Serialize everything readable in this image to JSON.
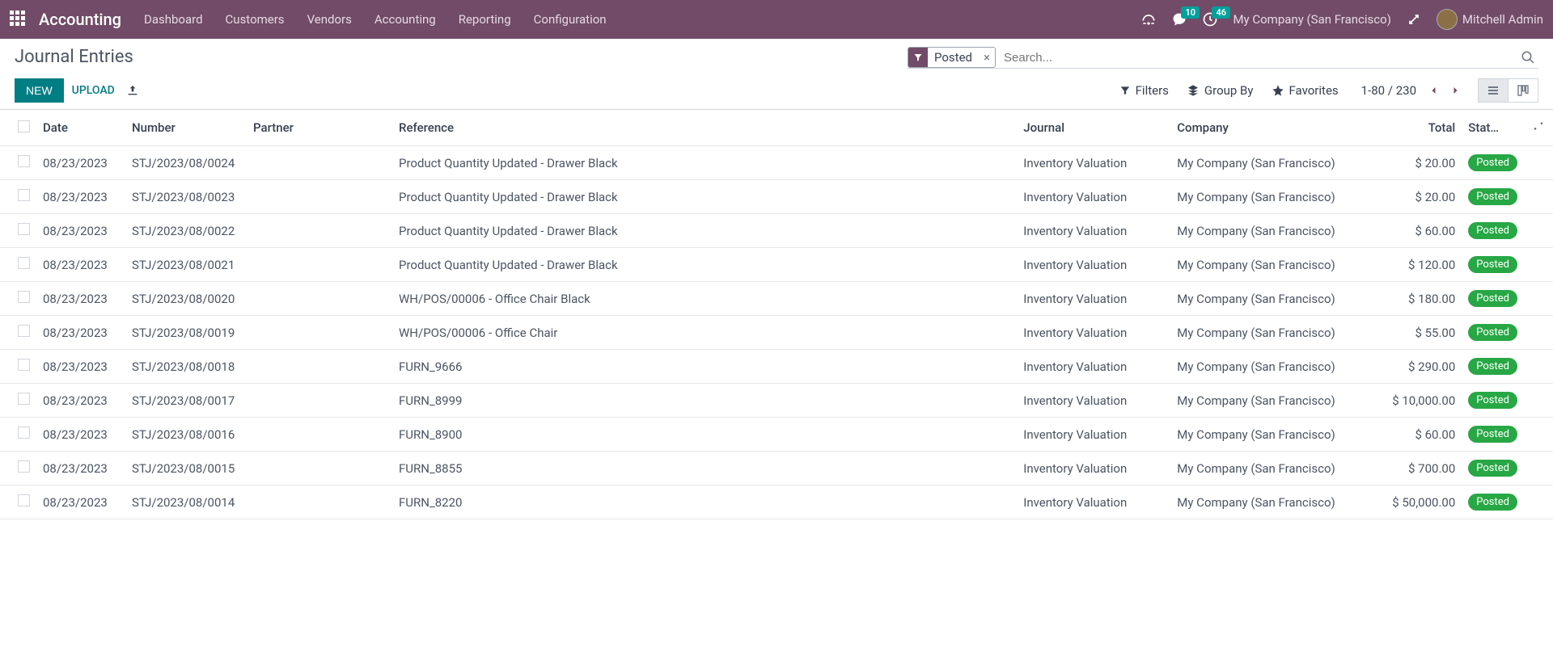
{
  "topbar": {
    "app_title": "Accounting",
    "menu": [
      "Dashboard",
      "Customers",
      "Vendors",
      "Accounting",
      "Reporting",
      "Configuration"
    ],
    "messages_badge": "10",
    "activities_badge": "46",
    "company": "My Company (San Francisco)",
    "user": "Mitchell Admin"
  },
  "control": {
    "breadcrumb": "Journal Entries",
    "new_btn": "NEW",
    "upload_btn": "UPLOAD",
    "filter_facet": "Posted",
    "search_placeholder": "Search...",
    "filters": "Filters",
    "groupby": "Group By",
    "favorites": "Favorites",
    "pager": "1-80 / 230"
  },
  "table": {
    "headers": {
      "date": "Date",
      "number": "Number",
      "partner": "Partner",
      "reference": "Reference",
      "journal": "Journal",
      "company": "Company",
      "total": "Total",
      "status": "Stat…"
    },
    "rows": [
      {
        "date": "08/23/2023",
        "number": "STJ/2023/08/0024",
        "partner": "",
        "reference": "Product Quantity Updated - Drawer Black",
        "journal": "Inventory Valuation",
        "company": "My Company (San Francisco)",
        "total": "$ 20.00",
        "status": "Posted"
      },
      {
        "date": "08/23/2023",
        "number": "STJ/2023/08/0023",
        "partner": "",
        "reference": "Product Quantity Updated - Drawer Black",
        "journal": "Inventory Valuation",
        "company": "My Company (San Francisco)",
        "total": "$ 20.00",
        "status": "Posted"
      },
      {
        "date": "08/23/2023",
        "number": "STJ/2023/08/0022",
        "partner": "",
        "reference": "Product Quantity Updated - Drawer Black",
        "journal": "Inventory Valuation",
        "company": "My Company (San Francisco)",
        "total": "$ 60.00",
        "status": "Posted"
      },
      {
        "date": "08/23/2023",
        "number": "STJ/2023/08/0021",
        "partner": "",
        "reference": "Product Quantity Updated - Drawer Black",
        "journal": "Inventory Valuation",
        "company": "My Company (San Francisco)",
        "total": "$ 120.00",
        "status": "Posted"
      },
      {
        "date": "08/23/2023",
        "number": "STJ/2023/08/0020",
        "partner": "",
        "reference": "WH/POS/00006 - Office Chair Black",
        "journal": "Inventory Valuation",
        "company": "My Company (San Francisco)",
        "total": "$ 180.00",
        "status": "Posted"
      },
      {
        "date": "08/23/2023",
        "number": "STJ/2023/08/0019",
        "partner": "",
        "reference": "WH/POS/00006 - Office Chair",
        "journal": "Inventory Valuation",
        "company": "My Company (San Francisco)",
        "total": "$ 55.00",
        "status": "Posted"
      },
      {
        "date": "08/23/2023",
        "number": "STJ/2023/08/0018",
        "partner": "",
        "reference": "FURN_9666",
        "journal": "Inventory Valuation",
        "company": "My Company (San Francisco)",
        "total": "$ 290.00",
        "status": "Posted"
      },
      {
        "date": "08/23/2023",
        "number": "STJ/2023/08/0017",
        "partner": "",
        "reference": "FURN_8999",
        "journal": "Inventory Valuation",
        "company": "My Company (San Francisco)",
        "total": "$ 10,000.00",
        "status": "Posted"
      },
      {
        "date": "08/23/2023",
        "number": "STJ/2023/08/0016",
        "partner": "",
        "reference": "FURN_8900",
        "journal": "Inventory Valuation",
        "company": "My Company (San Francisco)",
        "total": "$ 60.00",
        "status": "Posted"
      },
      {
        "date": "08/23/2023",
        "number": "STJ/2023/08/0015",
        "partner": "",
        "reference": "FURN_8855",
        "journal": "Inventory Valuation",
        "company": "My Company (San Francisco)",
        "total": "$ 700.00",
        "status": "Posted"
      },
      {
        "date": "08/23/2023",
        "number": "STJ/2023/08/0014",
        "partner": "",
        "reference": "FURN_8220",
        "journal": "Inventory Valuation",
        "company": "My Company (San Francisco)",
        "total": "$ 50,000.00",
        "status": "Posted"
      }
    ]
  }
}
